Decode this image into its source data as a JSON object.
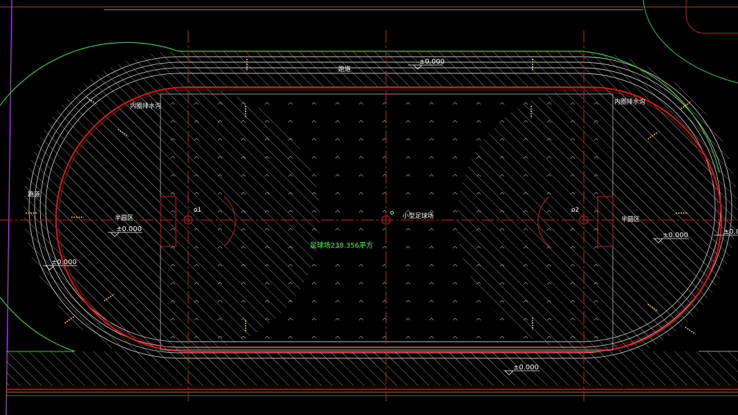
{
  "drawing": {
    "colors": {
      "background": "#000000",
      "outline_green": "#2fd22f",
      "track_lines": "#c8c8c8",
      "hatch": "#9a9a9a",
      "boundary_red": "#e01515",
      "axis_red": "#d21a1a",
      "field_marks": "#bdbdbd",
      "text_white": "#ffffff",
      "text_green": "#3cff3c",
      "dim_yellow": "#ffd21a",
      "road_orange": "#d2691e",
      "magenta": "#c03cff"
    },
    "labels": {
      "track_top": "跑道",
      "track_left": "跑道",
      "drain_left": "内圈排水沟",
      "drain_right": "内圈排水沟",
      "semicircle_left": "半圆区",
      "semicircle_right": "半圆区",
      "field_name": "小型足球场",
      "field_area": "足球场238.356平方",
      "point_o": "o",
      "point_o1": "o1",
      "point_o2": "o2"
    },
    "elevations": {
      "top": "±0.000",
      "left_inner": "±0.000",
      "left_outer": "±0.000",
      "right": "±0.000",
      "bottom": "±0.000",
      "right_edge": "±0.0"
    }
  }
}
